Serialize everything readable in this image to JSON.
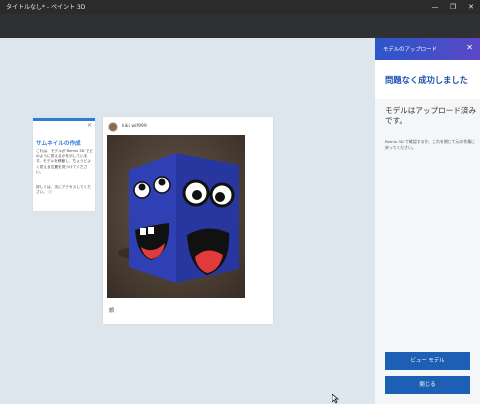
{
  "window": {
    "title": "タイトルなし* - ペイント 3D",
    "minimize_glyph": "—",
    "maximize_glyph": "❐",
    "close_glyph": "✕"
  },
  "tip": {
    "close_glyph": "✕",
    "title": "サムネイルの作成",
    "body": "これは、モデルが Remix 3D でどのように見えるかを示しています。モデルを移動し、ちょうどよく見える位置を見つけてください。",
    "body2": "詳しくは、次にアクセスしてください。 ⓘ"
  },
  "post": {
    "username": "kiki wif999",
    "caption": "顔"
  },
  "panel": {
    "header_title": "モデルのアップロード",
    "close_glyph": "✕",
    "success_title": "問題なく成功しました",
    "uploaded_msg": "モデルはアップロード済みです。",
    "note": "Remix 3D で確認するか、これを閉じて元の作業に戻ってください。",
    "view_button": "ビュー モデル",
    "close_button": "閉じる"
  },
  "colors": {
    "accent": "#1c5fb5",
    "cube_blue": "#2f3fb4",
    "mouth_red": "#e03a3a"
  }
}
